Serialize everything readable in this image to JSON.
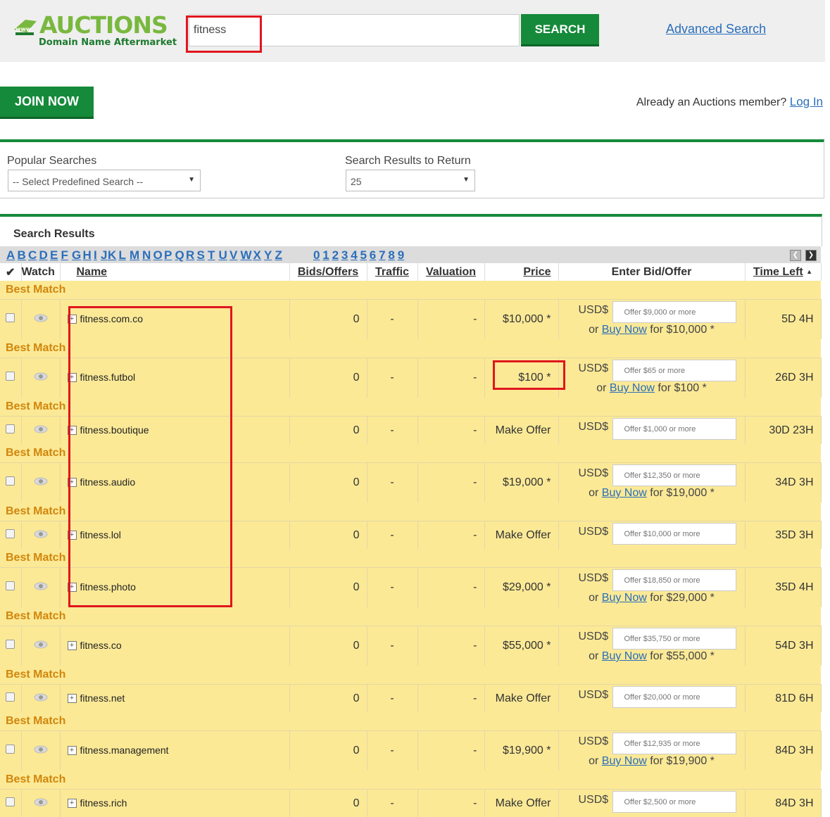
{
  "header": {
    "logo_title": "AUCTIONS",
    "logo_subtitle": "Domain Name Aftermarket",
    "search_value": "fitness",
    "search_button": "SEARCH",
    "advanced_search": "Advanced Search"
  },
  "account": {
    "join_button": "JOIN NOW",
    "member_text": "Already an Auctions member?",
    "login_link": "Log In"
  },
  "filters": {
    "popular_label": "Popular Searches",
    "popular_selected": "-- Select Predefined Search --",
    "return_label": "Search Results to Return",
    "return_selected": "25"
  },
  "results": {
    "title": "Search Results",
    "alphabet": [
      "A",
      "B",
      "C",
      "D",
      "E",
      "F",
      "G",
      "H",
      "I",
      "J",
      "K",
      "L",
      "M",
      "N",
      "O",
      "P",
      "Q",
      "R",
      "S",
      "T",
      "U",
      "V",
      "W",
      "X",
      "Y",
      "Z"
    ],
    "digits": [
      "0",
      "1",
      "2",
      "3",
      "4",
      "5",
      "6",
      "7",
      "8",
      "9"
    ],
    "columns": {
      "watch": "Watch",
      "name": "Name",
      "bids": "Bids/Offers",
      "traffic": "Traffic",
      "valuation": "Valuation",
      "price": "Price",
      "bid": "Enter Bid/Offer",
      "time": "Time Left"
    },
    "best_match_label": "Best Match",
    "currency": "USD$",
    "buy_now_prefix": "or",
    "buy_now_link": "Buy Now",
    "buy_now_for": "for",
    "rows": [
      {
        "name": "fitness.com.co",
        "bids": "0",
        "traffic": "-",
        "valuation": "-",
        "price": "$10,000 *",
        "offer_placeholder": "Offer $9,000 or more",
        "buy_now_price": "$10,000 *",
        "time_left": "5D 4H"
      },
      {
        "name": "fitness.futbol",
        "bids": "0",
        "traffic": "-",
        "valuation": "-",
        "price": "$100 *",
        "offer_placeholder": "Offer $65 or more",
        "buy_now_price": "$100 *",
        "time_left": "26D 3H"
      },
      {
        "name": "fitness.boutique",
        "bids": "0",
        "traffic": "-",
        "valuation": "-",
        "price": "Make Offer",
        "offer_placeholder": "Offer $1,000 or more",
        "buy_now_price": null,
        "time_left": "30D 23H"
      },
      {
        "name": "fitness.audio",
        "bids": "0",
        "traffic": "-",
        "valuation": "-",
        "price": "$19,000 *",
        "offer_placeholder": "Offer $12,350 or more",
        "buy_now_price": "$19,000 *",
        "time_left": "34D 3H"
      },
      {
        "name": "fitness.lol",
        "bids": "0",
        "traffic": "-",
        "valuation": "-",
        "price": "Make Offer",
        "offer_placeholder": "Offer $10,000 or more",
        "buy_now_price": null,
        "time_left": "35D 3H"
      },
      {
        "name": "fitness.photo",
        "bids": "0",
        "traffic": "-",
        "valuation": "-",
        "price": "$29,000 *",
        "offer_placeholder": "Offer $18,850 or more",
        "buy_now_price": "$29,000 *",
        "time_left": "35D 4H"
      },
      {
        "name": "fitness.co",
        "bids": "0",
        "traffic": "-",
        "valuation": "-",
        "price": "$55,000 *",
        "offer_placeholder": "Offer $35,750 or more",
        "buy_now_price": "$55,000 *",
        "time_left": "54D 3H"
      },
      {
        "name": "fitness.net",
        "bids": "0",
        "traffic": "-",
        "valuation": "-",
        "price": "Make Offer",
        "offer_placeholder": "Offer $20,000 or more",
        "buy_now_price": null,
        "time_left": "81D 6H"
      },
      {
        "name": "fitness.management",
        "bids": "0",
        "traffic": "-",
        "valuation": "-",
        "price": "$19,900 *",
        "offer_placeholder": "Offer $12,935 or more",
        "buy_now_price": "$19,900 *",
        "time_left": "84D 3H"
      },
      {
        "name": "fitness.rich",
        "bids": "0",
        "traffic": "-",
        "valuation": "-",
        "price": "Make Offer",
        "offer_placeholder": "Offer $2,500 or more",
        "buy_now_price": null,
        "time_left": "84D 3H"
      }
    ]
  },
  "colors": {
    "brand_green": "#158a3a",
    "logo_green": "#79b83e",
    "row_yellow": "#fbe996",
    "best_match_orange": "#d1860c",
    "link_blue": "#2a6ebb",
    "highlight_red": "#e0161e"
  }
}
